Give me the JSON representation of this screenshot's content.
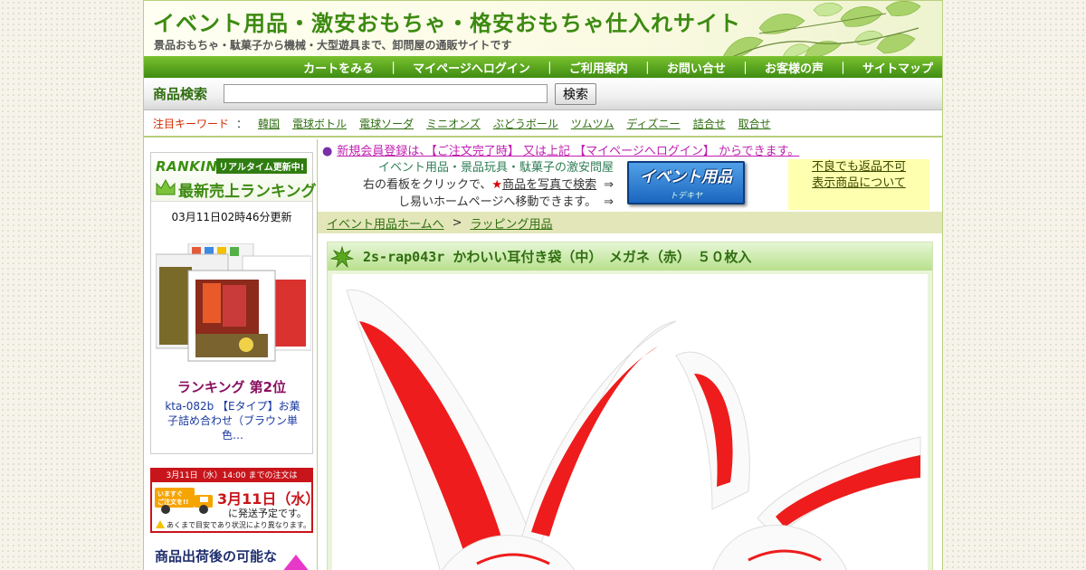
{
  "header": {
    "title": "イベント用品・激安おもちゃ・格安おもちゃ仕入れサイト",
    "subtitle": "景品おもちゃ・駄菓子から機械・大型遊具まで、卸問屋の通販サイトです"
  },
  "nav": {
    "items": [
      "カートをみる",
      "マイページへログイン",
      "ご利用案内",
      "お問い合せ",
      "お客様の声",
      "サイトマップ"
    ],
    "separator": "｜"
  },
  "search": {
    "label": "商品検索",
    "value": "",
    "placeholder": "",
    "button": "検索"
  },
  "keywords": {
    "label": "注目キーワード",
    "colon": "：",
    "items": [
      "韓国",
      "電球ボトル",
      "電球ソーダ",
      "ミニオンズ",
      "ぶどうボール",
      "ツムツム",
      "ディズニー",
      "詰合せ",
      "取合せ"
    ]
  },
  "ranking": {
    "banner_en": "RANKING!",
    "banner_badge": "リアルタイム更新中!",
    "banner_jp": "最新売上ランキング",
    "updated": "03月11日02時46分更新",
    "position": "ランキング 第2位",
    "product_name": "kta-082b 【Eタイプ】お菓子詰め合わせ（ブラウン単色…"
  },
  "shipping": {
    "header": "3月11日（水）14:00 までの注文は",
    "truck_text": "いますぐご注文を!!",
    "date": "3月11日（水）",
    "note": "に発送予定です。",
    "footnote": "あくまで目安であり状況により異なります。"
  },
  "after_ship": "商品出荷後の可能な",
  "notice": {
    "bullet": "●",
    "text": "新規会員登録は、【ご注文完了時】 又は上記 【マイページへログイン】 からできます。"
  },
  "promo": {
    "line1": "イベント用品・景品玩具・駄菓子の激安問屋",
    "line2_prefix": "右の看板をクリックで、",
    "star": "★",
    "line2_link": "商品を写真で検索",
    "line3": "し易いホームページへ移動できます。",
    "arrow": "⇒",
    "banner_main": "イベント用品",
    "banner_sub": "トデキヤ"
  },
  "returns": {
    "line1": "不良でも返品不可",
    "line2": "表示商品について"
  },
  "breadcrumb": {
    "home": "イベント用品ホームへ",
    "sep": ">",
    "category": "ラッピング用品"
  },
  "product": {
    "title": "2s-rap043r かわいい耳付き袋（中）　メガネ（赤）　５０枚入"
  },
  "colors": {
    "brand_green": "#3c8a11",
    "nav_green": "#4f9e1a",
    "notice_pink": "#c01fb0",
    "ship_red": "#c8151b",
    "rank_purple": "#8a1060"
  }
}
